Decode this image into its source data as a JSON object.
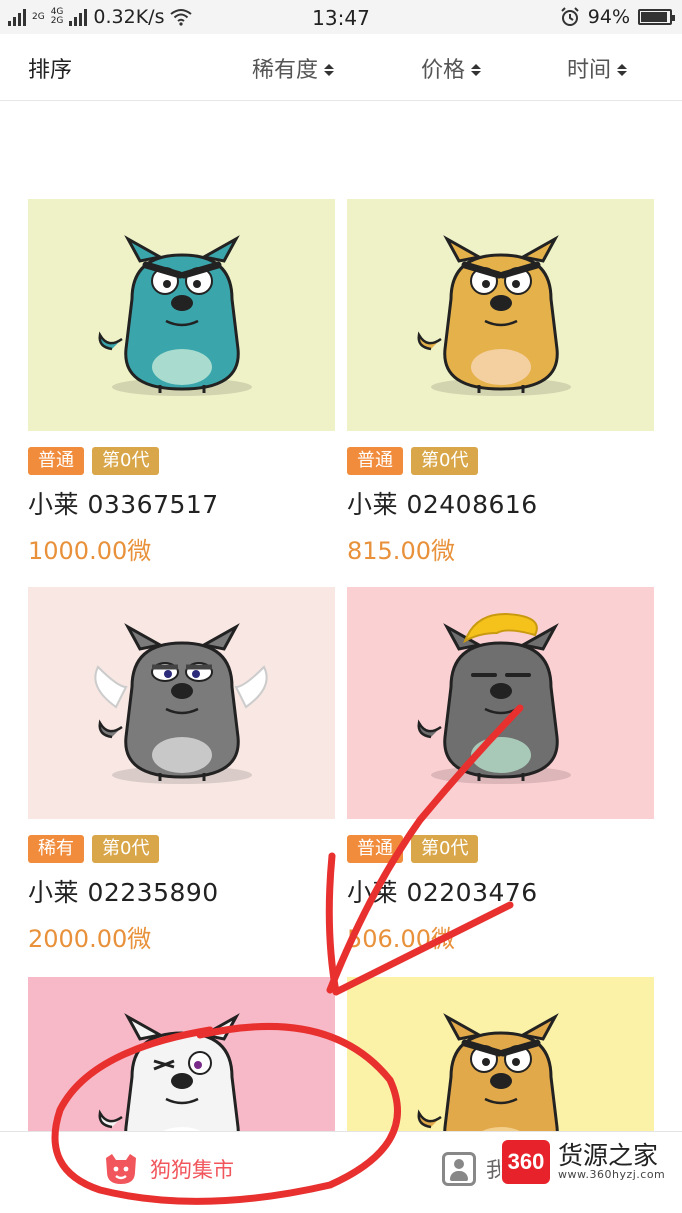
{
  "status_bar": {
    "network_2g": "2G",
    "network_4g": "4G",
    "network_4g_sub": "2G",
    "speed": "0.32K/s",
    "time": "13:47",
    "battery": "94%"
  },
  "sort_bar": {
    "title": "排序",
    "options": [
      "稀有度",
      "价格",
      "时间"
    ]
  },
  "dogs": [
    {
      "rarity": "普通",
      "generation": "第0代",
      "name": "小莱 03367517",
      "price": "1000.00微",
      "bg": "#eef2c6",
      "body": "#3aa6ac",
      "belly": "#a9dccf",
      "eye": "angry",
      "wings": false,
      "hair": false
    },
    {
      "rarity": "普通",
      "generation": "第0代",
      "name": "小莱 02408616",
      "price": "815.00微",
      "bg": "#eef2c6",
      "body": "#e5b14a",
      "belly": "#f4cfa0",
      "eye": "angry",
      "wings": false,
      "hair": false
    },
    {
      "rarity": "稀有",
      "generation": "第0代",
      "name": "小莱 02235890",
      "price": "2000.00微",
      "bg": "#f8e7e3",
      "body": "#7b7b7b",
      "belly": "#c8c8c8",
      "eye": "sleepy",
      "wings": true,
      "hair": false
    },
    {
      "rarity": "普通",
      "generation": "第0代",
      "name": "小莱 02203476",
      "price": "506.00微",
      "bg": "#fbd0d3",
      "body": "#6f6f6f",
      "belly": "#a9c9b8",
      "eye": "flat",
      "wings": false,
      "hair": true
    },
    {
      "bg": "#f7b8c7",
      "body": "#f4f4f4",
      "belly": "#ffffff",
      "eye": "wink",
      "wings": false,
      "hair": false
    },
    {
      "bg": "#fbf2a8",
      "body": "#e1a94a",
      "belly": "#f3cf8c",
      "eye": "angry",
      "wings": false,
      "hair": false
    }
  ],
  "bottom_nav": {
    "market_label": "狗狗集市",
    "mine_label": "我"
  },
  "watermark": {
    "logo_text": "360",
    "title": "货源之家",
    "url": "www.360hyzj.com"
  },
  "colors": {
    "accent": "#f0565c",
    "price": "#e8913a",
    "tag_rarity": "#f08c3c",
    "tag_gen": "#d9a74a",
    "annotation": "#e8302f"
  }
}
